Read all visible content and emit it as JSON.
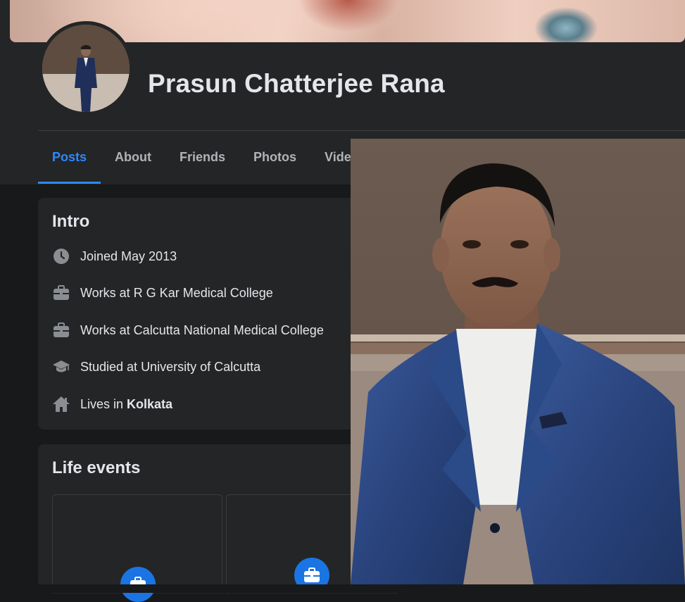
{
  "profile": {
    "name": "Prasun Chatterjee Rana"
  },
  "tabs": [
    {
      "label": "Posts",
      "active": true
    },
    {
      "label": "About",
      "active": false
    },
    {
      "label": "Friends",
      "active": false
    },
    {
      "label": "Photos",
      "active": false
    },
    {
      "label": "Videos",
      "active": false
    }
  ],
  "intro": {
    "title": "Intro",
    "items": [
      {
        "icon": "clock-icon",
        "text": "Joined May 2013"
      },
      {
        "icon": "briefcase-icon",
        "text": "Works at R G Kar Medical College"
      },
      {
        "icon": "briefcase-icon",
        "text": "Works at Calcutta National Medical College"
      },
      {
        "icon": "graduation-cap-icon",
        "text": "Studied at University of Calcutta"
      },
      {
        "icon": "home-icon",
        "prefix": "Lives in",
        "bold": "Kolkata"
      }
    ]
  },
  "life_events": {
    "title": "Life events"
  },
  "colors": {
    "background": "#18191a",
    "card": "#242526",
    "accent": "#2d88ff",
    "text_primary": "#e4e6eb",
    "text_secondary": "#b0b3b8"
  }
}
